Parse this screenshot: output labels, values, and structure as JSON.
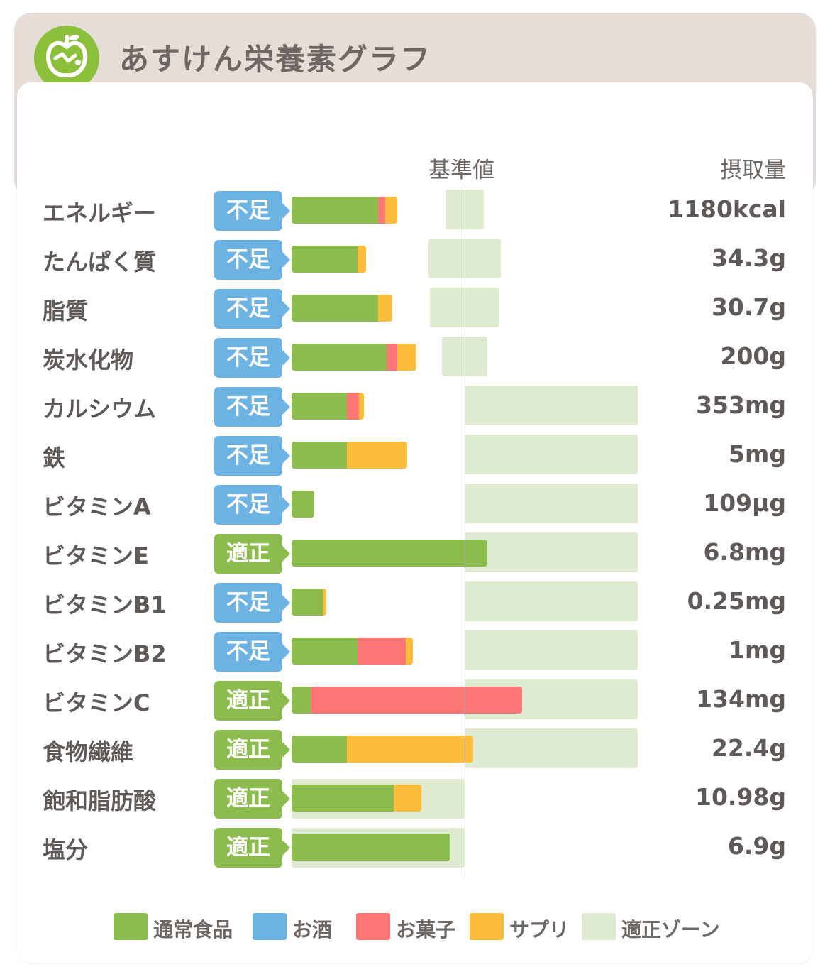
{
  "app": {
    "title": "あすけん栄養素グラフ",
    "logo_icon": "apple-logo-icon"
  },
  "columns": {
    "base_label": "基準値",
    "intake_label": "摂取量"
  },
  "colors": {
    "normal": "#8cbb4e",
    "alcohol": "#6cb2e2",
    "snack": "#fe7777",
    "supplement": "#fcbc3c",
    "zone": "#dfebd0",
    "badge_short": "#6cb2e2",
    "badge_ok": "#8cbb4e"
  },
  "chart_data": {
    "type": "bar",
    "orientation": "horizontal",
    "stacked": true,
    "reference_line_label": "基準値",
    "value_unit": "percent of reference (基準値 = 100)",
    "categories": [
      "エネルギー",
      "たんぱく質",
      "脂質",
      "炭水化物",
      "カルシウム",
      "鉄",
      "ビタミンA",
      "ビタミンE",
      "ビタミンB1",
      "ビタミンB2",
      "ビタミンC",
      "食物繊維",
      "飽和脂肪酸",
      "塩分"
    ],
    "status": [
      "不足",
      "不足",
      "不足",
      "不足",
      "不足",
      "不足",
      "不足",
      "適正",
      "不足",
      "不足",
      "適正",
      "適正",
      "適正",
      "適正"
    ],
    "intake": [
      "1180kcal",
      "34.3g",
      "30.7g",
      "200g",
      "353mg",
      "5mg",
      "109µg",
      "6.8mg",
      "0.25mg",
      "1mg",
      "134mg",
      "22.4g",
      "10.98g",
      "6.9g"
    ],
    "series": [
      {
        "name": "通常食品",
        "color": "#8cbb4e",
        "values": [
          50,
          38,
          50,
          55,
          32,
          32,
          13,
          113,
          18,
          38,
          11,
          32,
          59,
          92
        ]
      },
      {
        "name": "お酒",
        "color": "#6cb2e2",
        "values": [
          0,
          0,
          0,
          0,
          0,
          0,
          0,
          0,
          0,
          0,
          0,
          0,
          0,
          0
        ]
      },
      {
        "name": "お菓子",
        "color": "#fe7777",
        "values": [
          4,
          0,
          0,
          6,
          7,
          0,
          0,
          0,
          0,
          28,
          122,
          0,
          0,
          0
        ]
      },
      {
        "name": "サプリ",
        "color": "#fcbc3c",
        "values": [
          7,
          5,
          8,
          11,
          3,
          35,
          0,
          0,
          2,
          4,
          0,
          73,
          16,
          0
        ]
      }
    ],
    "zones": [
      [
        89,
        111
      ],
      [
        79,
        121
      ],
      [
        80,
        120
      ],
      [
        87,
        113
      ],
      [
        100,
        200
      ],
      [
        100,
        200
      ],
      [
        100,
        200
      ],
      [
        100,
        200
      ],
      [
        100,
        200
      ],
      [
        100,
        200
      ],
      [
        100,
        200
      ],
      [
        100,
        200
      ],
      [
        0,
        100
      ],
      [
        0,
        100
      ]
    ],
    "xlim": [
      0,
      200
    ],
    "legend": [
      "通常食品",
      "お酒",
      "お菓子",
      "サプリ",
      "適正ゾーン"
    ],
    "legend_position": "bottom"
  }
}
